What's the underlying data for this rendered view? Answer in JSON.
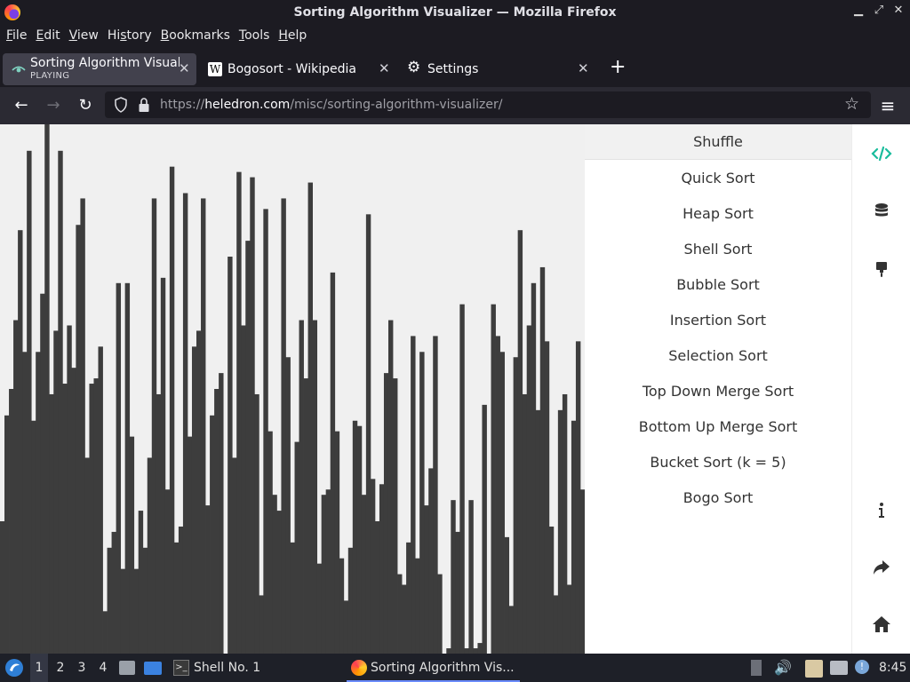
{
  "window": {
    "title": "Sorting Algorithm Visualizer — Mozilla Firefox",
    "controls": {
      "minimize": "▁",
      "maximize": "⤢",
      "close": "✕"
    }
  },
  "menu": [
    {
      "pre": "",
      "u": "F",
      "post": "ile"
    },
    {
      "pre": "",
      "u": "E",
      "post": "dit"
    },
    {
      "pre": "",
      "u": "V",
      "post": "iew"
    },
    {
      "pre": "Hi",
      "u": "s",
      "post": "tory"
    },
    {
      "pre": "",
      "u": "B",
      "post": "ookmarks"
    },
    {
      "pre": "",
      "u": "T",
      "post": "ools"
    },
    {
      "pre": "",
      "u": "H",
      "post": "elp"
    }
  ],
  "tabs": [
    {
      "title": "Sorting Algorithm Visualizer",
      "sub": "PLAYING",
      "icon": "visualizer-eye-icon",
      "active": true
    },
    {
      "title": "Bogosort - Wikipedia",
      "icon": "wikipedia-w-icon",
      "active": false
    },
    {
      "title": "Settings",
      "icon": "gear-icon",
      "active": false
    }
  ],
  "urlbar": {
    "prefix": "https://",
    "domain": "heledron.com",
    "path": "/misc/sorting-algorithm-visualizer/"
  },
  "algorithms": {
    "shuffle": "Shuffle",
    "items": [
      "Quick Sort",
      "Heap Sort",
      "Shell Sort",
      "Bubble Sort",
      "Insertion Sort",
      "Selection Sort",
      "Top Down Merge Sort",
      "Bottom Up Merge Sort",
      "Bucket Sort (k = 5)",
      "Bogo Sort"
    ]
  },
  "sidebar_icons": [
    "code-icon",
    "database-icon",
    "brush-icon",
    "info-icon",
    "share-icon",
    "home-icon"
  ],
  "visualizer": {
    "bar_color": "#3d3d3d",
    "bar_values": [
      25,
      45,
      50,
      63,
      80,
      57,
      95,
      44,
      57,
      68,
      100,
      49,
      61,
      95,
      51,
      62,
      54,
      81,
      86,
      37,
      51,
      52,
      58,
      8,
      20,
      23,
      70,
      16,
      70,
      41,
      16,
      27,
      20,
      37,
      86,
      49,
      71,
      31,
      92,
      21,
      24,
      87,
      41,
      58,
      61,
      86,
      28,
      45,
      50,
      53,
      0,
      75,
      37,
      91,
      62,
      78,
      90,
      49,
      11,
      84,
      42,
      30,
      27,
      86,
      56,
      21,
      40,
      63,
      52,
      89,
      63,
      17,
      30,
      31,
      72,
      42,
      18,
      10,
      20,
      44,
      43,
      30,
      83,
      33,
      25,
      32,
      53,
      63,
      52,
      15,
      13,
      21,
      60,
      18,
      57,
      28,
      35,
      60,
      15,
      0,
      1,
      29,
      23,
      66,
      1,
      29,
      1,
      2,
      47,
      0,
      66,
      60,
      57,
      22,
      9,
      56,
      80,
      49,
      62,
      70,
      46,
      73,
      59,
      24,
      11,
      46,
      49,
      13,
      44,
      59,
      31
    ]
  },
  "taskbar": {
    "workspaces": [
      "1",
      "2",
      "3",
      "4"
    ],
    "shell": "Shell No. 1",
    "firefox": "Sorting Algorithm Vis...",
    "clock": "8:45"
  }
}
